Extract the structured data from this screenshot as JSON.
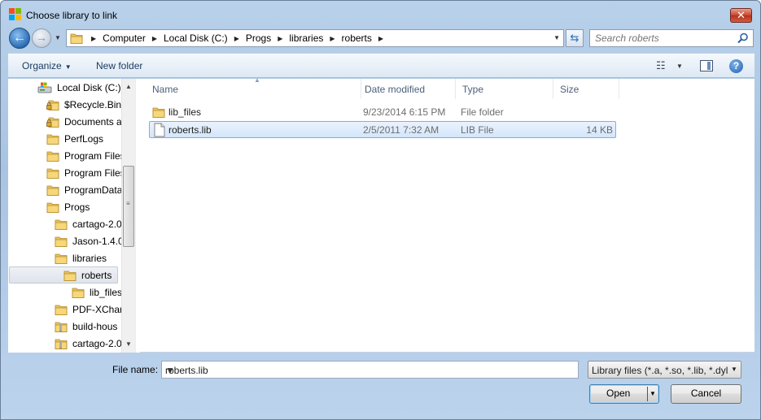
{
  "window": {
    "title": "Choose library to link"
  },
  "address": {
    "crumbs": [
      "Computer",
      "Local Disk (C:)",
      "Progs",
      "libraries",
      "roberts"
    ]
  },
  "search": {
    "placeholder": "Search roberts"
  },
  "toolbar": {
    "organize_label": "Organize",
    "new_folder_label": "New folder"
  },
  "nav_tree": {
    "items": [
      {
        "label": "Local Disk (C:)",
        "icon": "drive-icon"
      },
      {
        "label": "$Recycle.Bin",
        "icon": "locked-folder-icon"
      },
      {
        "label": "Documents a",
        "icon": "locked-folder-icon"
      },
      {
        "label": "PerfLogs",
        "icon": "folder-icon"
      },
      {
        "label": "Program Files",
        "icon": "folder-icon"
      },
      {
        "label": "Program Files",
        "icon": "folder-icon"
      },
      {
        "label": "ProgramData",
        "icon": "folder-icon"
      },
      {
        "label": "Progs",
        "icon": "folder-icon"
      },
      {
        "label": "cartago-2.0",
        "icon": "folder-icon"
      },
      {
        "label": "Jason-1.4.0",
        "icon": "folder-icon"
      },
      {
        "label": "libraries",
        "icon": "folder-icon"
      },
      {
        "label": "roberts",
        "icon": "folder-icon"
      },
      {
        "label": "lib_files",
        "icon": "folder-icon"
      },
      {
        "label": "PDF-XChar",
        "icon": "folder-icon"
      },
      {
        "label": "build-hous",
        "icon": "zip-folder-icon"
      },
      {
        "label": "cartago-2.0",
        "icon": "zip-folder-icon"
      }
    ]
  },
  "file_list": {
    "columns": [
      "Name",
      "Date modified",
      "Type",
      "Size"
    ],
    "rows": [
      {
        "name": "lib_files",
        "date": "9/23/2014 6:15 PM",
        "type": "File folder",
        "size": "",
        "icon": "folder-icon"
      },
      {
        "name": "roberts.lib",
        "date": "2/5/2011 7:32 AM",
        "type": "LIB File",
        "size": "14 KB",
        "icon": "file-icon"
      }
    ]
  },
  "footer": {
    "filename_label": "File name:",
    "filename_value": "roberts.lib",
    "filter_value": "Library files (*.a, *.so, *.lib, *.dyl",
    "open_label": "Open",
    "cancel_label": "Cancel"
  },
  "colors": {
    "selection": "#d4e6fb",
    "selection_border": "#84acdd",
    "chrome": "#b9d1ea"
  }
}
